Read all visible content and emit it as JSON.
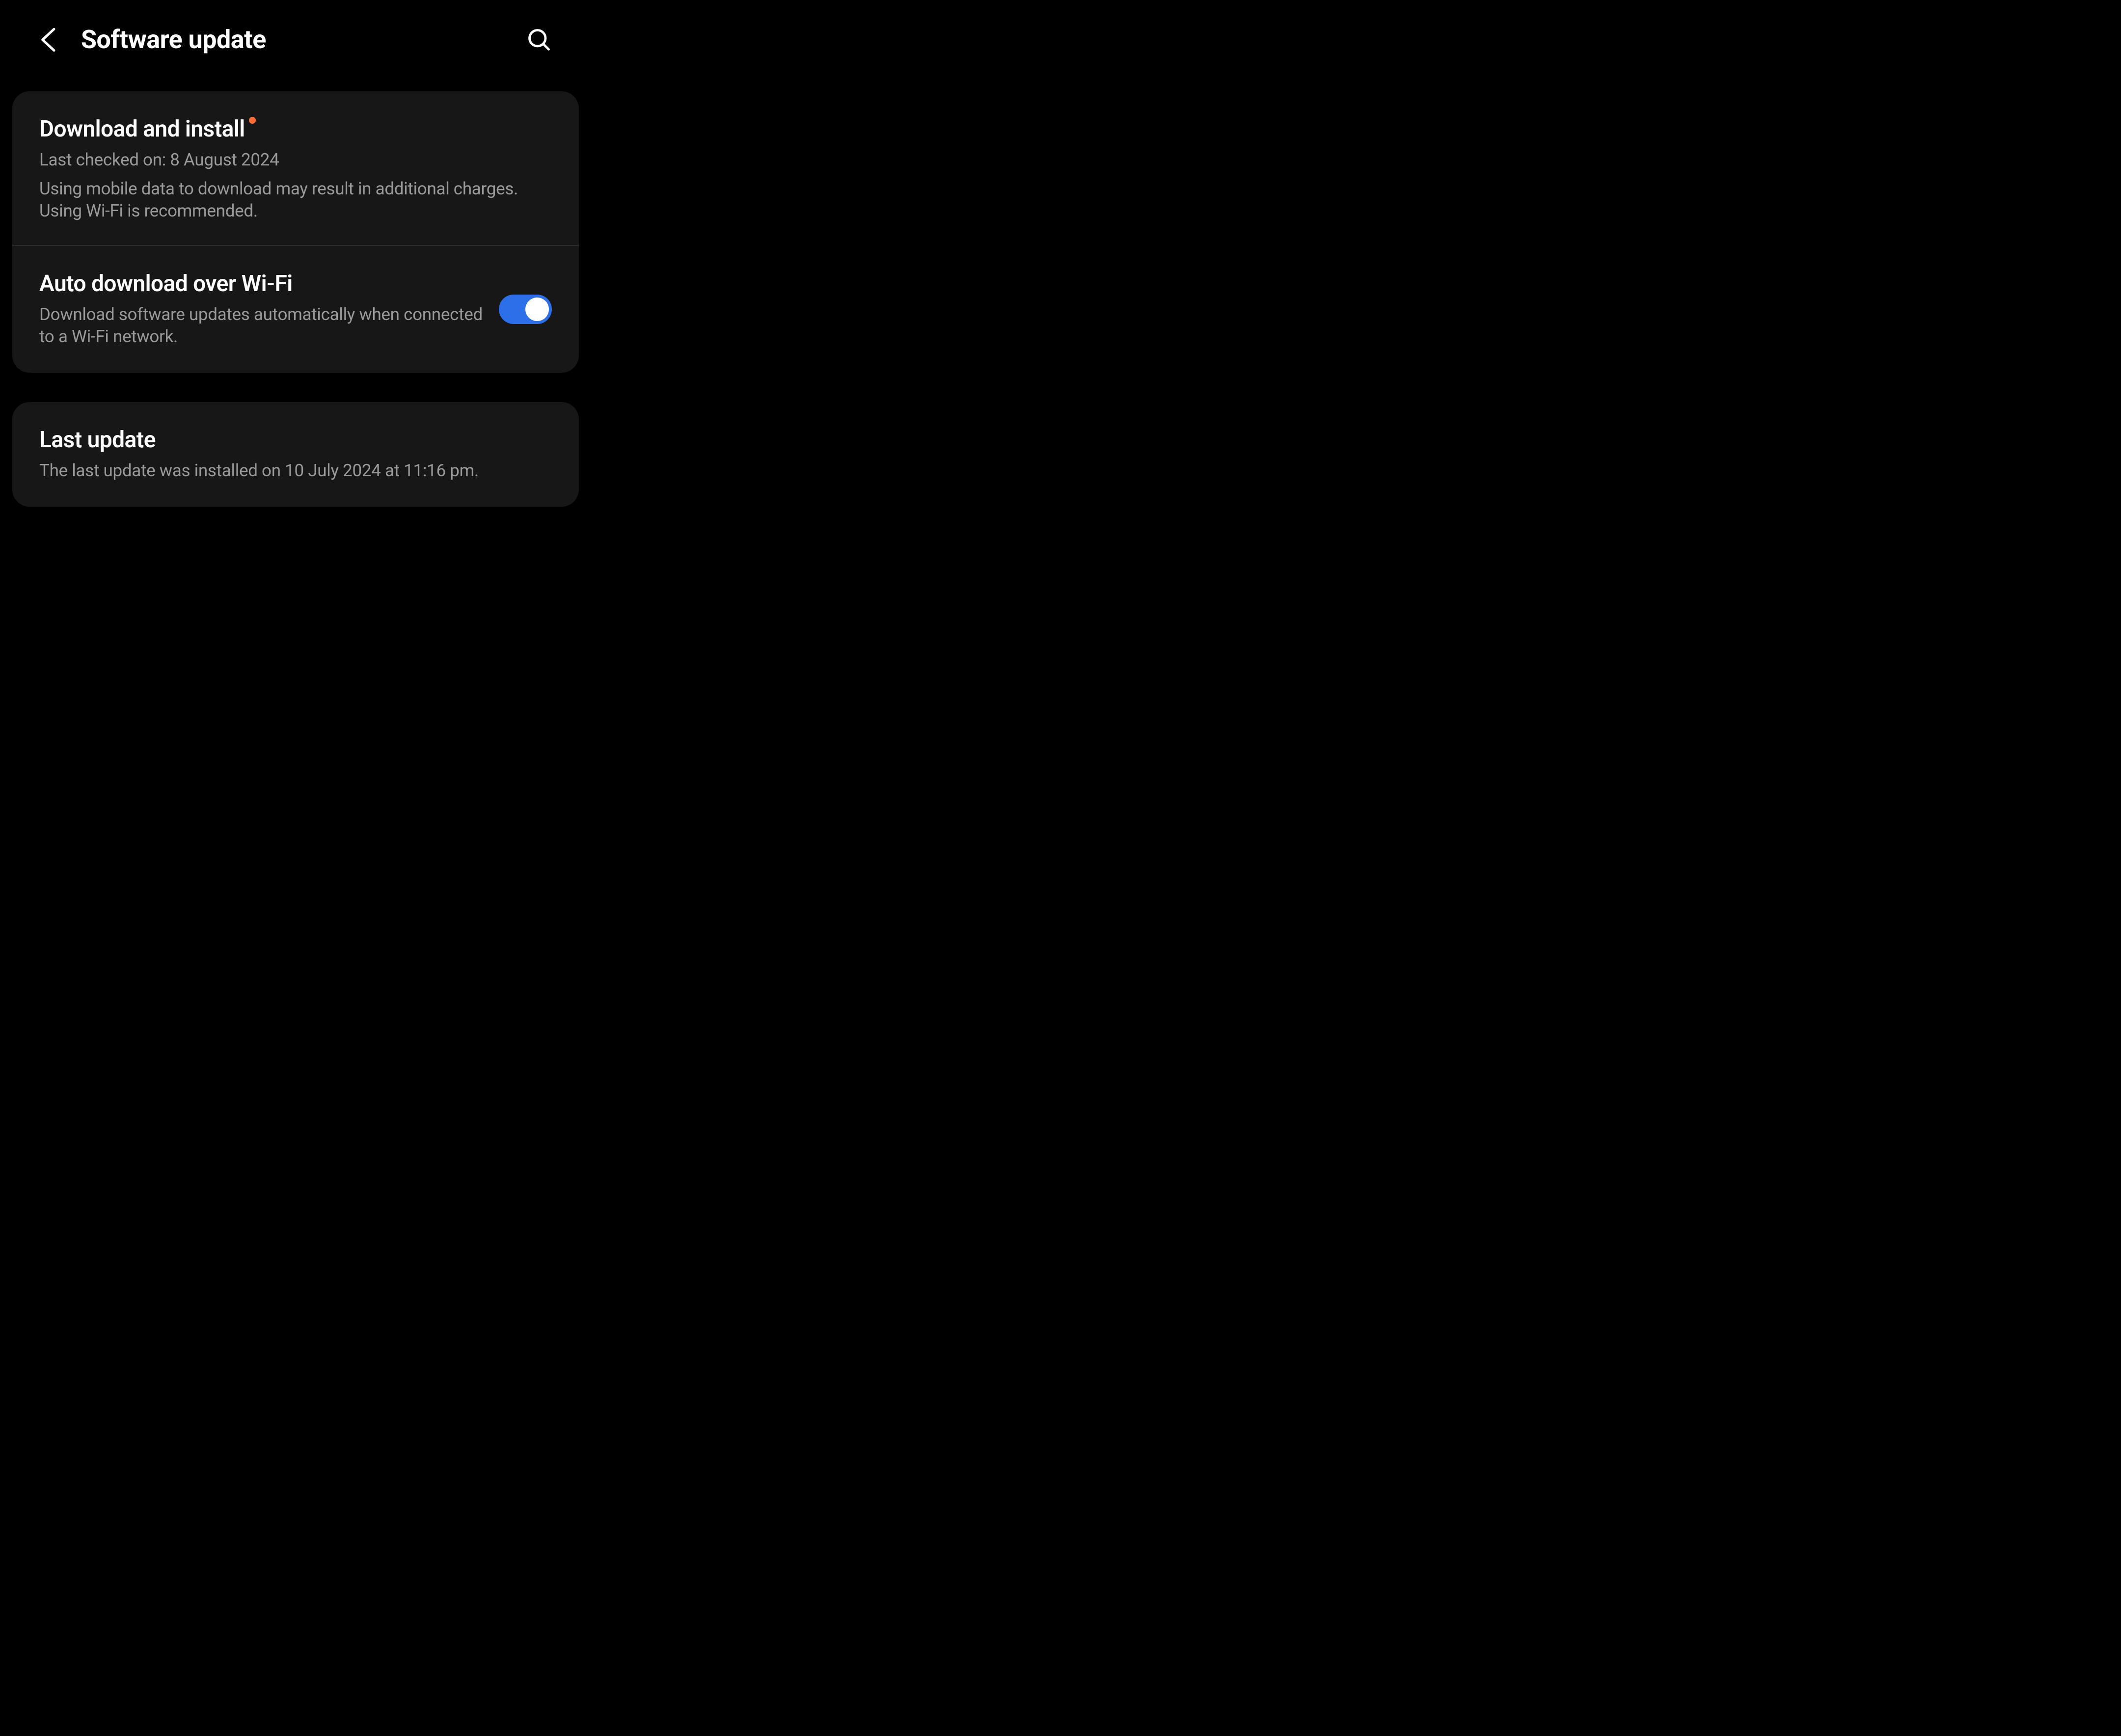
{
  "header": {
    "title": "Software update"
  },
  "download_install": {
    "title": "Download and install",
    "last_checked": "Last checked on: 8 August 2024",
    "warning": "Using mobile data to download may result in additional charges. Using Wi-Fi is recommended."
  },
  "auto_download": {
    "title": "Auto download over Wi-Fi",
    "description": "Download software updates automatically when connected to a Wi-Fi network.",
    "enabled": true
  },
  "last_update": {
    "title": "Last update",
    "description": "The last update was installed on 10 July 2024 at 11:16 pm."
  }
}
